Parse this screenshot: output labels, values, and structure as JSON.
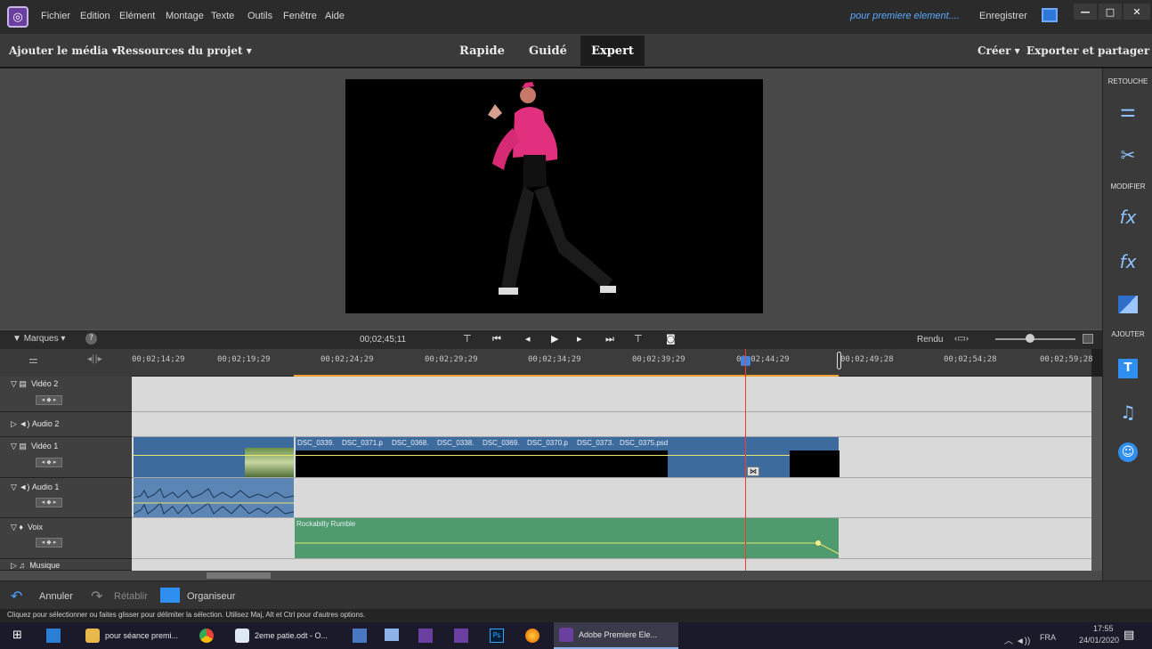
{
  "titlebar": {
    "menus": [
      "Fichier",
      "Edition",
      "Elément",
      "Montage",
      "Texte",
      "Outils",
      "Fenêtre",
      "Aide"
    ],
    "project_name": "pour premiere element....",
    "save_label": "Enregistrer"
  },
  "modebar": {
    "add_media": "Ajouter le média ▾",
    "project_assets": "Ressources du projet ▾",
    "tabs": [
      "Rapide",
      "Guidé",
      "Expert"
    ],
    "active_tab": "Expert",
    "create": "Créer ▾",
    "export": "Exporter et partager"
  },
  "right_panel": {
    "retouch": "RETOUCHE",
    "modify": "MODIFIER",
    "add": "AJOUTER"
  },
  "timeline": {
    "markers": "Marques ▾",
    "timecode": "00;02;45;11",
    "render": "Rendu",
    "ruler_labels": [
      "00;02;14;29",
      "00;02;19;29",
      "00;02;24;29",
      "00;02;29;29",
      "00;02;34;29",
      "00;02;39;29",
      "00;02;44;29",
      "00;02;49;28",
      "00;02;54;28",
      "00;02;59;28"
    ],
    "tracks": [
      {
        "name": "Vidéo 2"
      },
      {
        "name": "Audio 2"
      },
      {
        "name": "Vidéo 1"
      },
      {
        "name": "Audio 1"
      },
      {
        "name": "Voix"
      },
      {
        "name": "Musique"
      }
    ],
    "video_clips": [
      "DSC_0339.",
      "DSC_0371.p",
      "DSC_0368.",
      "DSC_0338.",
      "DSC_0369.",
      "DSC_0370.p",
      "DSC_0373.",
      "DSC_0375.psd"
    ],
    "voice_clip": "Rockabilly Rumble"
  },
  "bottom_bar": {
    "undo": "Annuler",
    "redo": "Rétablir",
    "organizer": "Organiseur"
  },
  "status_text": "Cliquez pour sélectionner ou faites glisser pour délimiter la sélection. Utilisez Maj, Alt et Ctrl pour d'autres options.",
  "taskbar": {
    "items": [
      "pour séance premi...",
      "2eme patie.odt - O...",
      "Adobe Premiere Ele..."
    ],
    "lang": "FRA",
    "time": "17:55",
    "date": "24/01/2020"
  }
}
